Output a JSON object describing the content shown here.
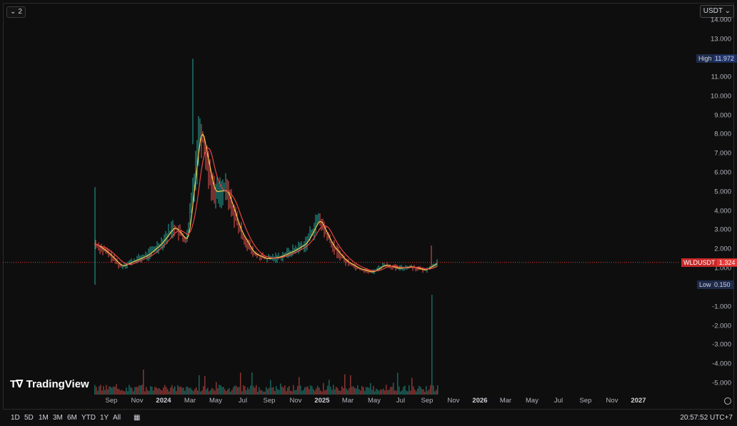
{
  "toolbar": {
    "intervals_label": "2",
    "currency": "USDT"
  },
  "price_axis": {
    "ticks": [
      "14.000",
      "13.000",
      "11.000",
      "10.000",
      "9.000",
      "8.000",
      "7.000",
      "6.000",
      "5.000",
      "4.000",
      "3.000",
      "2.000",
      "1.000",
      "-1.000",
      "-2.000",
      "-3.000",
      "-4.000",
      "-5.000"
    ],
    "high_label": "High",
    "high_value": "11.972",
    "low_label": "Low",
    "low_value": "0.150",
    "symbol_label": "WLDUSDT",
    "last_price": "1.324"
  },
  "time_axis": {
    "ticks": [
      "Sep",
      "Nov",
      "2024",
      "Mar",
      "May",
      "Jul",
      "Sep",
      "Nov",
      "2025",
      "Mar",
      "May",
      "Jul",
      "Sep",
      "Nov",
      "2026",
      "Mar",
      "May",
      "Jul",
      "Sep",
      "Nov",
      "2027"
    ]
  },
  "brand": {
    "name": "TradingView"
  },
  "range_buttons": [
    "1D",
    "5D",
    "1M",
    "3M",
    "6M",
    "YTD",
    "1Y",
    "All"
  ],
  "clock": "20:57:52 UTC+7",
  "colors": {
    "up": "#26a69a",
    "down": "#ef5350",
    "ma_yellow": "#f7c948",
    "ma_red": "#e64545",
    "high_bg": "#1e2a4a",
    "last_bg": "#e53935"
  },
  "chart_data": {
    "type": "line",
    "x": [
      "2023-07",
      "2023-08",
      "2023-09",
      "2023-10",
      "2023-11",
      "2023-12",
      "2024-01",
      "2024-02",
      "2024-03",
      "2024-04",
      "2024-05",
      "2024-06",
      "2024-07",
      "2024-08",
      "2024-09",
      "2024-10",
      "2024-11",
      "2024-12",
      "2025-01",
      "2025-02",
      "2025-03",
      "2025-04",
      "2025-05",
      "2025-06",
      "2025-07",
      "2025-08",
      "2025-09"
    ],
    "series": [
      {
        "values": [
          2.3,
          1.8,
          1.1,
          1.4,
          1.7,
          2.3,
          3.2,
          2.4,
          8.5,
          5.0,
          5.1,
          3.0,
          1.8,
          1.5,
          1.6,
          1.9,
          2.3,
          3.6,
          2.2,
          1.4,
          1.0,
          0.8,
          1.2,
          1.0,
          1.1,
          0.9,
          1.32
        ]
      }
    ],
    "ylim": [
      -5.5,
      14.5
    ]
  }
}
